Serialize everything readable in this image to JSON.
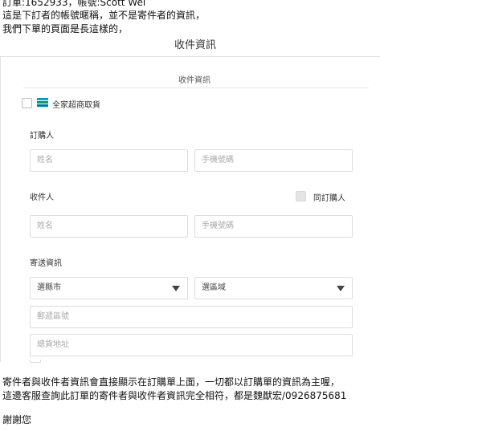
{
  "email": {
    "line1": "訂單:1652933，帳號:Scott Wei",
    "line2": "這是下訂者的帳號暱稱，並不是寄件者的資訊，",
    "line3": "我們下單的頁面是長這樣的，",
    "footer_line1": "寄件者與收件者資訊會直接顯示在訂購單上面，一切都以訂購單的資訊為主喔，",
    "footer_line2": "這邊客服查詢此訂單的寄件者與收件者資訊完全相符，都是魏猷宏/0926875681",
    "thanks": "謝謝您"
  },
  "screenshot_title": "收件資訊",
  "form": {
    "title": "收件資訊",
    "store_option_label": "全家超商取貨",
    "store_icon_colors": [
      "#00a0e0",
      "#00a651",
      "#0072bc"
    ],
    "orderer": {
      "section_label": "訂購人",
      "name_placeholder": "姓名",
      "phone_placeholder": "手機號碼"
    },
    "recipient": {
      "section_label": "收件人",
      "same_as_orderer_label": "同訂購人",
      "name_placeholder": "姓名",
      "phone_placeholder": "手機號碼"
    },
    "shipping": {
      "section_label": "寄送資訊",
      "city_select": "選縣市",
      "district_select": "選區域",
      "zip_placeholder": "郵遞區號",
      "address_placeholder": "總貨地址"
    }
  }
}
